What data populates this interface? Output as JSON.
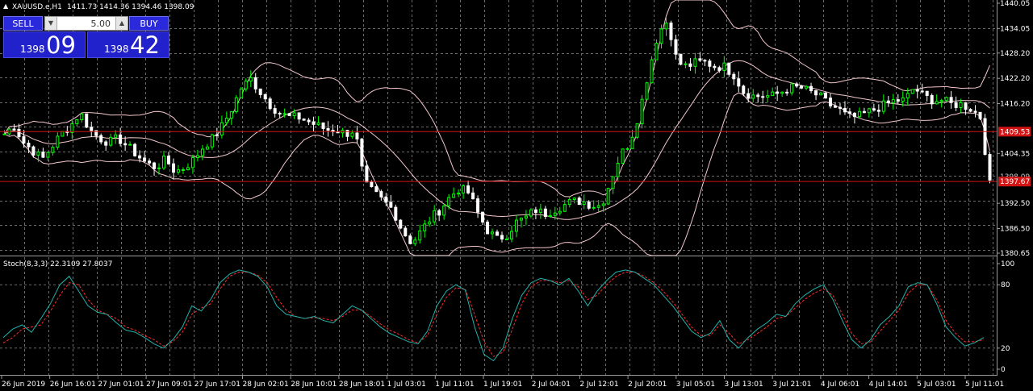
{
  "window": {
    "symbol_label": "XAUUSD.e,H1",
    "ohlc": "1411.73 1414.36 1394.46 1398.09"
  },
  "trade_panel": {
    "sell_label": "SELL",
    "buy_label": "BUY",
    "lot_value": "5.00",
    "sell_price_small": "1398",
    "sell_price_big": "09",
    "buy_price_small": "1398",
    "buy_price_big": "42"
  },
  "indicator": {
    "label": "Stoch(8,3,3) 22.3109 27.8037",
    "levels": [
      "100",
      "80",
      "20",
      "0"
    ]
  },
  "price_axis": {
    "ticks": [
      "1440.05",
      "1434.05",
      "1428.20",
      "1422.20",
      "1416.20",
      "1404.35",
      "1392.50",
      "1386.50",
      "1380.65"
    ],
    "marker_upper": "1409.53",
    "marker_lower": "1397.67",
    "marker_faint": "1398.09"
  },
  "time_axis": {
    "ticks": [
      "26 Jun 2019",
      "26 Jun 16:01",
      "27 Jun 01:01",
      "27 Jun 09:01",
      "27 Jun 17:01",
      "28 Jun 02:01",
      "28 Jun 10:01",
      "28 Jun 18:01",
      "1 Jul 03:01",
      "1 Jul 11:01",
      "1 Jul 19:01",
      "2 Jul 04:01",
      "2 Jul 12:01",
      "2 Jul 20:01",
      "3 Jul 05:01",
      "3 Jul 13:01",
      "3 Jul 21:01",
      "4 Jul 06:01",
      "4 Jul 14:01",
      "5 Jul 03:01",
      "5 Jul 11:01"
    ]
  },
  "colors": {
    "background": "#000000",
    "grid": "#6b6b6b",
    "candle_up": "#00ff00",
    "candle_down": "#ffffff",
    "bands": "#f4c7cc",
    "hline": "#d31414",
    "stoch_main": "#20b2aa",
    "stoch_signal": "#ff2a2a",
    "axis_text": "#ffffff"
  },
  "chart_data": {
    "type": "candlestick",
    "close_path": [
      1409,
      1411,
      1407,
      1405,
      1403,
      1406,
      1409,
      1411,
      1414,
      1410,
      1408,
      1407,
      1408,
      1406,
      1404,
      1402,
      1401,
      1403,
      1400,
      1401,
      1403,
      1406,
      1408,
      1411,
      1415,
      1420,
      1422,
      1419,
      1416,
      1414,
      1413,
      1413,
      1412,
      1411,
      1410,
      1410,
      1409,
      1410,
      1397,
      1395,
      1393,
      1391,
      1386,
      1383,
      1386,
      1389,
      1391,
      1394,
      1396,
      1395,
      1390,
      1386,
      1384,
      1385,
      1388,
      1389,
      1391,
      1390,
      1391,
      1392,
      1393,
      1393,
      1392,
      1392,
      1398,
      1404,
      1407,
      1414,
      1424,
      1433,
      1436,
      1426,
      1425,
      1426,
      1426,
      1425,
      1425,
      1423,
      1419,
      1418,
      1418,
      1418,
      1419,
      1420,
      1420,
      1419,
      1418,
      1416,
      1415,
      1413,
      1413,
      1414,
      1415,
      1416,
      1417,
      1417,
      1420,
      1418,
      1417,
      1417,
      1416,
      1416,
      1415,
      1413,
      1397
    ],
    "stoch_k": [
      30,
      38,
      42,
      35,
      48,
      62,
      80,
      88,
      74,
      60,
      54,
      52,
      44,
      37,
      35,
      30,
      24,
      20,
      28,
      40,
      60,
      55,
      66,
      82,
      90,
      94,
      92,
      88,
      78,
      60,
      52,
      50,
      48,
      50,
      46,
      44,
      52,
      60,
      56,
      48,
      40,
      34,
      30,
      26,
      24,
      36,
      60,
      74,
      80,
      75,
      40,
      14,
      8,
      20,
      48,
      70,
      82,
      86,
      84,
      80,
      86,
      74,
      60,
      74,
      84,
      92,
      94,
      92,
      86,
      80,
      70,
      60,
      48,
      36,
      30,
      34,
      46,
      28,
      20,
      30,
      38,
      44,
      52,
      50,
      62,
      70,
      76,
      80,
      66,
      46,
      28,
      20,
      28,
      42,
      50,
      60,
      78,
      82,
      80,
      62,
      40,
      30,
      22,
      25,
      30
    ],
    "stoch_d": [
      25,
      30,
      38,
      40,
      42,
      55,
      70,
      82,
      80,
      66,
      56,
      52,
      48,
      40,
      37,
      32,
      28,
      22,
      26,
      35,
      52,
      58,
      62,
      76,
      88,
      92,
      92,
      89,
      82,
      68,
      56,
      50,
      48,
      49,
      48,
      46,
      50,
      56,
      56,
      50,
      43,
      37,
      33,
      28,
      25,
      32,
      52,
      68,
      77,
      76,
      52,
      26,
      12,
      16,
      38,
      62,
      78,
      84,
      84,
      82,
      84,
      78,
      66,
      70,
      80,
      88,
      92,
      92,
      88,
      82,
      74,
      64,
      52,
      40,
      32,
      32,
      42,
      34,
      24,
      28,
      34,
      40,
      48,
      50,
      58,
      66,
      72,
      76,
      70,
      52,
      34,
      24,
      26,
      36,
      46,
      56,
      72,
      80,
      80,
      66,
      46,
      34,
      26,
      26,
      28
    ],
    "ylim_price": [
      1380.65,
      1440.05
    ],
    "ylim_stoch": [
      0,
      100
    ],
    "grid": true
  }
}
